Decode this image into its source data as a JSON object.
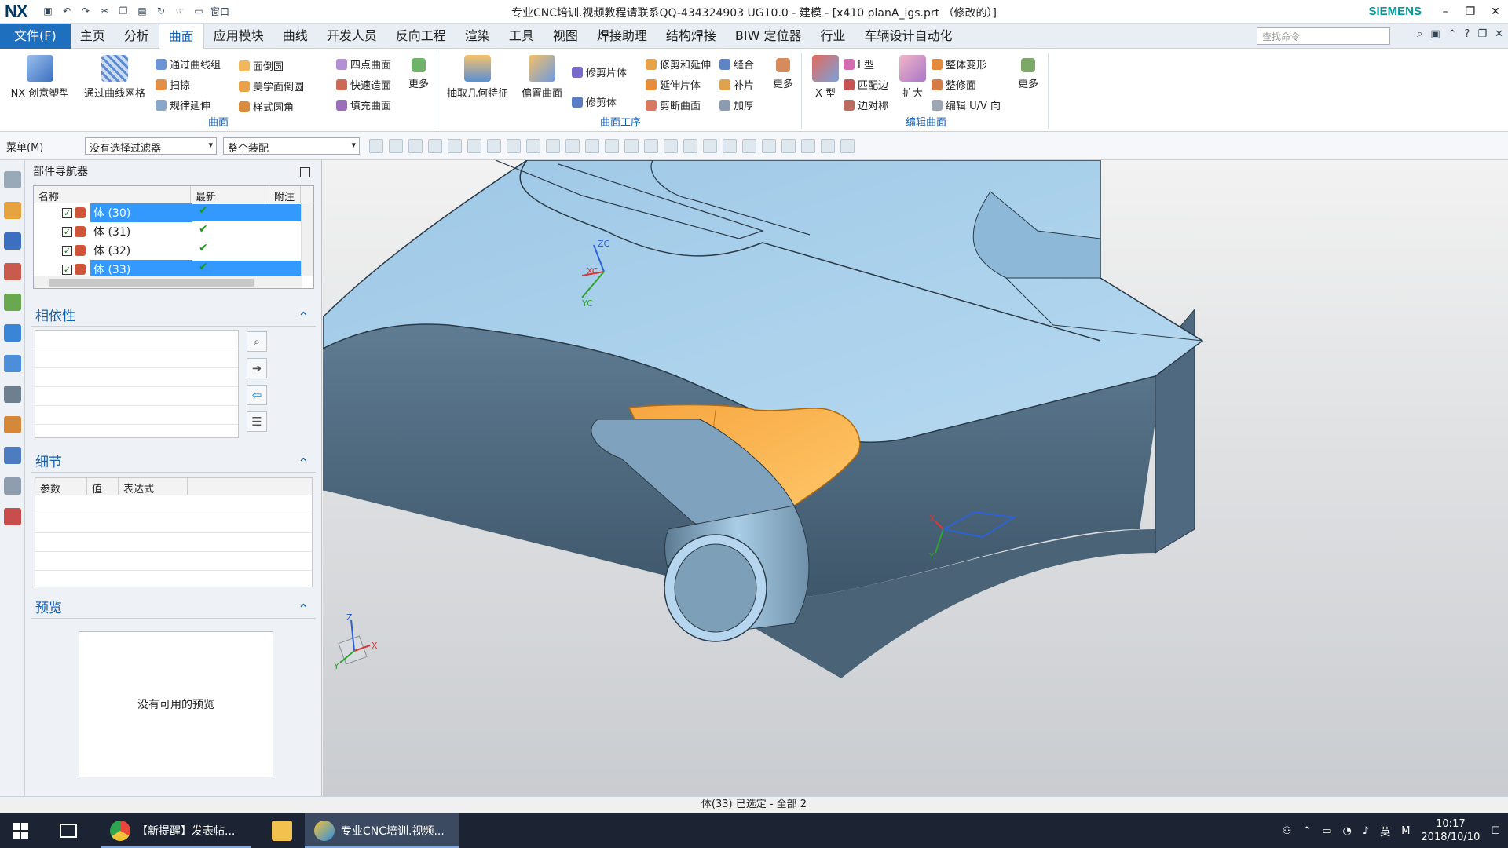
{
  "window": {
    "app_logo": "NX",
    "title": "专业CNC培训.视频教程请联系QQ-434324903 UG10.0 - 建模 - [x410 planA_igs.prt （修改的）]",
    "brand": "SIEMENS",
    "qat_window": "窗口"
  },
  "menubar": {
    "file": "文件(F)",
    "tabs": [
      "主页",
      "分析",
      "曲面",
      "应用模块",
      "曲线",
      "开发人员",
      "反向工程",
      "渲染",
      "工具",
      "视图",
      "焊接助理",
      "结构焊接",
      "BIW 定位器",
      "行业",
      "车辆设计自动化"
    ],
    "active_tab": "曲面",
    "search_placeholder": "查找命令"
  },
  "ribbon": {
    "groups": {
      "surface": {
        "label": "曲面",
        "big": [
          "NX 创意塑型",
          "通过曲线网格"
        ],
        "small": [
          "通过曲线组",
          "扫掠",
          "规律延伸",
          "面倒圆",
          "美学面倒圆",
          "样式圆角",
          "四点曲面",
          "快速造面",
          "填充曲面"
        ],
        "more": "更多"
      },
      "surface_ops": {
        "label": "曲面工序",
        "big": [
          "抽取几何特征",
          "偏置曲面"
        ],
        "small": [
          "修剪片体",
          "修剪体",
          "修剪和延伸",
          "延伸片体",
          "剪断曲面",
          "缝合",
          "补片",
          "加厚"
        ],
        "more": "更多"
      },
      "edit_surface": {
        "label": "编辑曲面",
        "big": [
          "X 型",
          "扩大"
        ],
        "small": [
          "I 型",
          "匹配边",
          "边对称",
          "整体变形",
          "整修面",
          "编辑 U/V 向"
        ],
        "more": "更多"
      }
    }
  },
  "toolbar": {
    "menu": "菜单(M)",
    "filter": "没有选择过滤器",
    "assembly": "整个装配"
  },
  "part_navigator": {
    "title": "部件导航器",
    "columns": [
      "名称",
      "最新",
      "附注"
    ],
    "rows": [
      {
        "label": "体 (30)",
        "latest": "✔",
        "selected": true
      },
      {
        "label": "体 (31)",
        "latest": "✔",
        "selected": false
      },
      {
        "label": "体 (32)",
        "latest": "✔",
        "selected": false
      },
      {
        "label": "体 (33)",
        "latest": "✔",
        "selected": true
      }
    ]
  },
  "dependency": {
    "title": "相依性"
  },
  "details": {
    "title": "细节",
    "columns": [
      "参数",
      "值",
      "表达式"
    ]
  },
  "preview": {
    "title": "预览",
    "empty_text": "没有可用的预览"
  },
  "viewport": {
    "axis_zc": "ZC",
    "axis_xc": "XC",
    "axis_yc": "YC",
    "triad_z": "Z",
    "triad_y": "Y",
    "triad_x": "X",
    "csys_x": "X",
    "csys_y": "Y"
  },
  "status": {
    "text": "体(33) 已选定 - 全部 2"
  },
  "taskbar": {
    "apps": [
      {
        "label": "【新提醒】发表帖...",
        "color": "#e8453c"
      },
      {
        "label": "专业CNC培训.视频...",
        "color": "#2f8fe0"
      }
    ],
    "lang": "英",
    "time": "10:17",
    "date": "2018/10/10"
  }
}
